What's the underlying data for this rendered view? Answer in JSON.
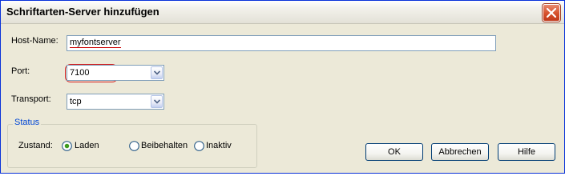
{
  "window": {
    "title": "Schriftarten-Server hinzufügen"
  },
  "form": {
    "host_label": "Host-Name:",
    "host_value": "myfontserver",
    "port_label": "Port:",
    "port_value": "7100",
    "transport_label": "Transport:",
    "transport_value": "tcp"
  },
  "status": {
    "group_label": "Status",
    "zustand_label": "Zustand:",
    "options": [
      {
        "label": "Laden",
        "selected": true
      },
      {
        "label": "Beibehalten",
        "selected": false
      },
      {
        "label": "Inaktiv",
        "selected": false
      }
    ]
  },
  "buttons": {
    "ok": "OK",
    "cancel": "Abbrechen",
    "help": "Hilfe"
  },
  "colors": {
    "accent": "#0046d5",
    "highlight_ring": "#d31d1d",
    "window_bg": "#ece9d8",
    "close_button": "#d6502b"
  }
}
